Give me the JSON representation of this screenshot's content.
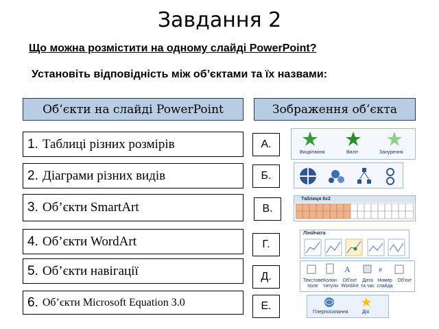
{
  "title": "Завдання 2",
  "question": "Що можна розмістити на одному слайді PowerPoint?",
  "instruction": "Установіть відповідність між об’єктами та їх назвами:",
  "headers": {
    "objects": "Об’єкти на слайді  PowerPoint",
    "images": "Зображення  об’єкта"
  },
  "objects": [
    {
      "num": "1.",
      "text": "Таблиці різних розмірів"
    },
    {
      "num": "2.",
      "text": "Діаграми різних видів"
    },
    {
      "num": "3.",
      "text": "Об’єкти SmartArt"
    },
    {
      "num": "4.",
      "text": "Об’єкти WordArt"
    },
    {
      "num": "5.",
      "text": "Об’єкти навігації"
    },
    {
      "num": "6.",
      "text": "Об’єкти Microsoft Equation 3.0"
    }
  ],
  "letters": [
    "А.",
    "Б.",
    "В.",
    "Г.",
    "Д.",
    "Е."
  ],
  "images": {
    "a": {
      "labels": [
        "Вицвітання",
        "Виліт",
        "Занурення"
      ]
    },
    "c": {
      "label": "Таблиця 8x2"
    },
    "d": {
      "label": "Лінійчата"
    },
    "e": {
      "labels": [
        "Текстове поле",
        "Колон- титули",
        "Об’єкт WordArt",
        "Дата та час",
        "Номер слайда",
        "Об’єкт"
      ]
    },
    "f": {
      "labels": [
        "Гіперпосилання",
        "Дія"
      ]
    }
  },
  "colors": {
    "header_bg": "#b8cce4",
    "accent": "#1f3864",
    "star": "#3a9a3a"
  }
}
